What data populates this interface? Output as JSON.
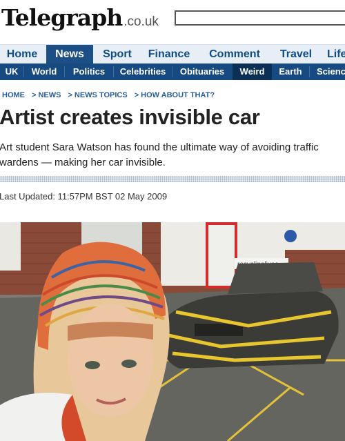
{
  "masthead": {
    "logo": "Telegraph",
    "logo_suffix": ".co.uk",
    "search_placeholder": ""
  },
  "primary_nav": [
    {
      "label": "Home",
      "active": false
    },
    {
      "label": "News",
      "active": true
    },
    {
      "label": "Sport",
      "active": false
    },
    {
      "label": "Finance",
      "active": false
    },
    {
      "label": "Comment",
      "active": false
    },
    {
      "label": "Travel",
      "active": false
    },
    {
      "label": "Life",
      "active": false
    }
  ],
  "secondary_nav": [
    {
      "label": "UK",
      "active": false
    },
    {
      "label": "World",
      "active": false
    },
    {
      "label": "Politics",
      "active": false
    },
    {
      "label": "Celebrities",
      "active": false
    },
    {
      "label": "Obituaries",
      "active": false
    },
    {
      "label": "Weird",
      "active": true
    },
    {
      "label": "Earth",
      "active": false
    },
    {
      "label": "Science",
      "active": false
    }
  ],
  "breadcrumb": [
    "HOME",
    "NEWS",
    "NEWS TOPICS",
    "HOW ABOUT THAT?"
  ],
  "article": {
    "headline": "Artist creates invisible car",
    "standfirst": "Art student Sara Watson has found the ultimate way of avoiding traffic wardens — making her car invisible.",
    "updated": "Last Updated: 11:57PM BST 02 May 2009"
  },
  "photo": {
    "sign_text": "recyclinglives"
  },
  "colors": {
    "nav_light": "#e8eef5",
    "nav_dark": "#164a80",
    "active_tab": "#1b4f86",
    "link_blue": "#0f4c86"
  }
}
